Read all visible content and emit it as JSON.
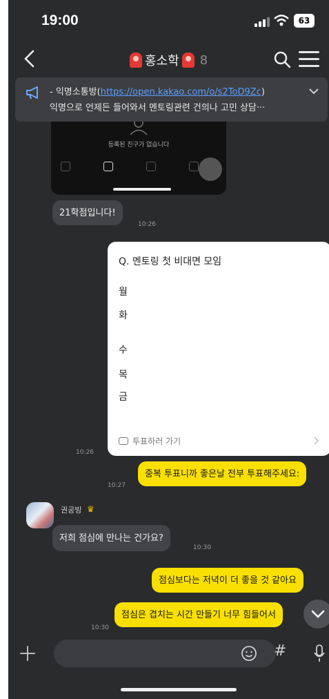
{
  "status_bar": {
    "time": "19:00",
    "battery": "63"
  },
  "header": {
    "title": "홍소학",
    "member_count": "8"
  },
  "notice": {
    "prefix": "- 익명소통방(",
    "link": "https://open.kakao.com/o/s2ToD9Zc",
    "suffix": ")",
    "line2": "익명으로 언제든 들어와서 멘토링관련 건의나 고민 상담···"
  },
  "embedded_screenshot": {
    "empty_text": "등록된 친구가 없습니다"
  },
  "messages": [
    {
      "side": "in",
      "text": "21학점입니다!",
      "time": "10:26"
    },
    {
      "side": "out",
      "type": "poll",
      "time": "10:26"
    },
    {
      "side": "out",
      "text": "중복 투표니까 좋은날 전부 투표해주세요:",
      "time": "10:27"
    },
    {
      "side": "in",
      "sender": "권공빙",
      "text": "저희 점심에 만나는 건가요?",
      "time": "10:30"
    },
    {
      "side": "out",
      "text": "점심보다는 저녁이 더 좋을 것 같아요"
    },
    {
      "side": "out",
      "text": "점심은 겹치는 시간 만들기 너무 힘들어서",
      "time": "10:30"
    }
  ],
  "poll": {
    "question": "Q. 멘토링 첫 비대면 모임",
    "options": [
      "월",
      "화",
      "수",
      "목",
      "금"
    ],
    "action_label": "투표하러 가기"
  },
  "input_bar": {
    "hash_label": "#"
  }
}
